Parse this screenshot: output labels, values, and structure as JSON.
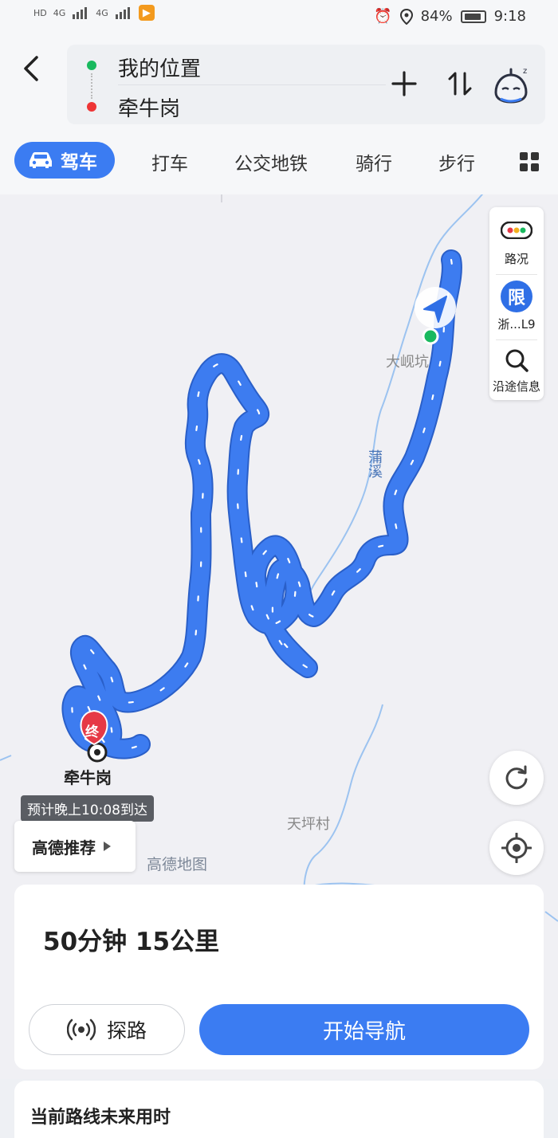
{
  "status_bar": {
    "left_icons": [
      "HD",
      "HD",
      "4G",
      "4G"
    ],
    "battery": "84%",
    "time": "9:18"
  },
  "header": {
    "origin": "我的位置",
    "destination": "牵牛岗"
  },
  "modes": [
    {
      "label": "驾车",
      "active": true
    },
    {
      "label": "打车",
      "active": false
    },
    {
      "label": "公交地铁",
      "active": false
    },
    {
      "label": "骑行",
      "active": false
    },
    {
      "label": "步行",
      "active": false
    }
  ],
  "map": {
    "labels": {
      "start_village": "大岘坑",
      "stream": "蒲溪",
      "village2": "天坪村",
      "watermark": "高德地图"
    },
    "end_marker": "终",
    "end_label": "牵牛岗",
    "eta": "预计晚上10:08到达",
    "recommend": "高德推荐",
    "side_panel": {
      "traffic": "路况",
      "limit_badge": "限",
      "limit": "浙...L9",
      "along_route": "沿途信息"
    }
  },
  "route": {
    "summary": "50分钟  15公里",
    "explore": "探路",
    "start_nav": "开始导航"
  },
  "future": {
    "title": "当前路线未来用时"
  },
  "colors": {
    "accent": "#3b7cf2",
    "route": "#3d7cf0",
    "start_dot": "#19b95e",
    "end_dot": "#ee3535",
    "end_marker": "#e63946"
  }
}
